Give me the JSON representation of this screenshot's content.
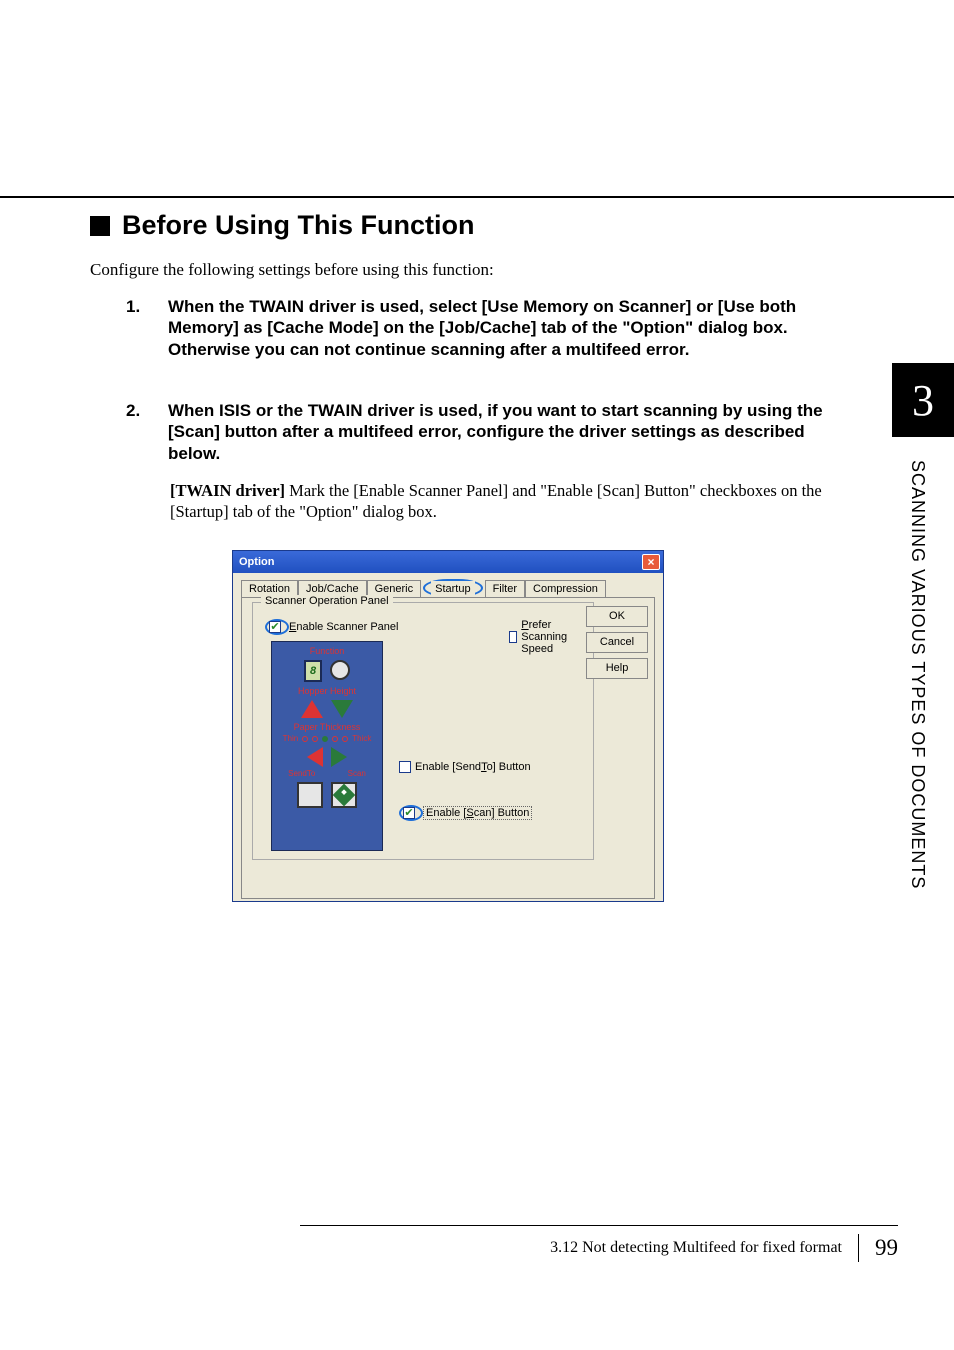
{
  "section_title": "Before Using This Function",
  "intro": "Configure the following settings before using this function:",
  "steps": {
    "1": "When the TWAIN driver is used, select [Use Memory on Scanner] or [Use both Memory] as [Cache Mode] on the [Job/Cache] tab of the \"Option\" dialog box. Otherwise you can not continue scanning after a multifeed error.",
    "2": "When ISIS or the TWAIN driver is used, if you want to start scanning by using the [Scan] button after a multifeed error, configure the driver settings as described below."
  },
  "twain_label": "[TWAIN driver]",
  "twain_text": " Mark the [Enable Scanner Panel] and \"Enable [Scan] Button\" checkboxes on the [Startup] tab of the \"Option\" dialog box.",
  "dialog": {
    "title": "Option",
    "tabs": [
      "Rotation",
      "Job/Cache",
      "Generic",
      "Startup",
      "Filter",
      "Compression"
    ],
    "fieldset_legend": "Scanner Operation Panel",
    "enable_panel_checked": true,
    "enable_panel_label_u": "E",
    "enable_panel_label_rest": "nable Scanner Panel",
    "prefer_speed_checked": false,
    "prefer_speed_label_u": "P",
    "prefer_speed_label_rest": "refer Scanning Speed",
    "sendto_checked": false,
    "sendto_prefix": "Enable [Send",
    "sendto_u": "T",
    "sendto_suffix": "o] Button",
    "scanbtn_checked": true,
    "scanbtn_prefix": "Enable [",
    "scanbtn_u": "S",
    "scanbtn_suffix": "can] Button",
    "panel": {
      "function": "Function",
      "digit": "8",
      "hopper": "Hopper Height",
      "paper": "Paper Thickness",
      "thin": "Thin",
      "thick": "Thick",
      "sendto": "SendTo",
      "scan": "Scan"
    },
    "buttons": {
      "ok": "OK",
      "cancel": "Cancel",
      "help": "Help"
    }
  },
  "side": {
    "chapter": "3",
    "title": "SCANNING VARIOUS TYPES OF DOCUMENTS"
  },
  "footer": {
    "section": "3.12 Not detecting Multifeed for fixed format",
    "page": "99"
  }
}
